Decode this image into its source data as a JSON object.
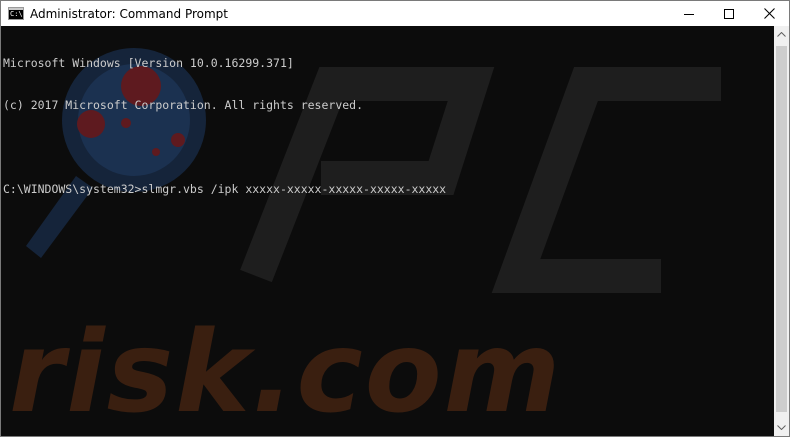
{
  "window": {
    "title": "Administrator: Command Prompt",
    "app_icon_text": "C:\\"
  },
  "caption_buttons": [
    "minimize",
    "maximize",
    "close"
  ],
  "console": {
    "lines": [
      "Microsoft Windows [Version 10.0.16299.371]",
      "(c) 2017 Microsoft Corporation. All rights reserved.",
      "",
      "C:\\WINDOWS\\system32>slmgr.vbs /ipk xxxxx-xxxxx-xxxxx-xxxxx-xxxxx"
    ],
    "text_color": "#cccccc",
    "background_color": "#0c0c0c"
  },
  "watermark": {
    "text": "risk.com",
    "logo_letters": "PC",
    "text_color": "#a3521e"
  },
  "icons": {
    "minimize": "minimize-icon",
    "maximize": "maximize-icon",
    "close": "close-icon",
    "scroll_up": "scroll-up-arrow-icon",
    "scroll_down": "scroll-down-arrow-icon"
  }
}
